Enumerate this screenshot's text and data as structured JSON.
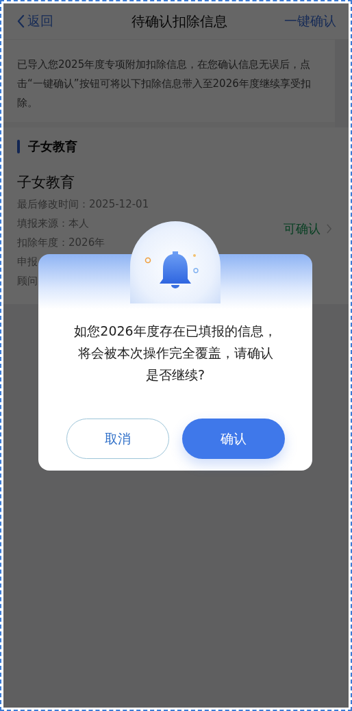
{
  "nav": {
    "back": "返回",
    "title": "待确认扣除信息",
    "action": "一键确认"
  },
  "notice": "已导入您2025年度专项附加扣除信息，在您确认信息无误后，点击“一键确认”按钮可将以下扣除信息带入至2026年度继续享受扣除。",
  "section": {
    "title": "子女教育",
    "items": [
      {
        "name": "子女教育",
        "fields": [
          "最后修改时间：2025-12-01",
          "填报来源：本人",
          "扣除年度：2026年",
          "申报",
          "顾问"
        ],
        "status": "可确认"
      }
    ]
  },
  "dialog": {
    "message_lines": [
      "如您2026年度存在已填报的信息，",
      "将会被本次操作完全覆盖，请确认",
      "是否继续?"
    ],
    "buttons": [
      {
        "label": "取消",
        "kind": "secondary"
      },
      {
        "label": "确认",
        "kind": "primary"
      }
    ]
  }
}
